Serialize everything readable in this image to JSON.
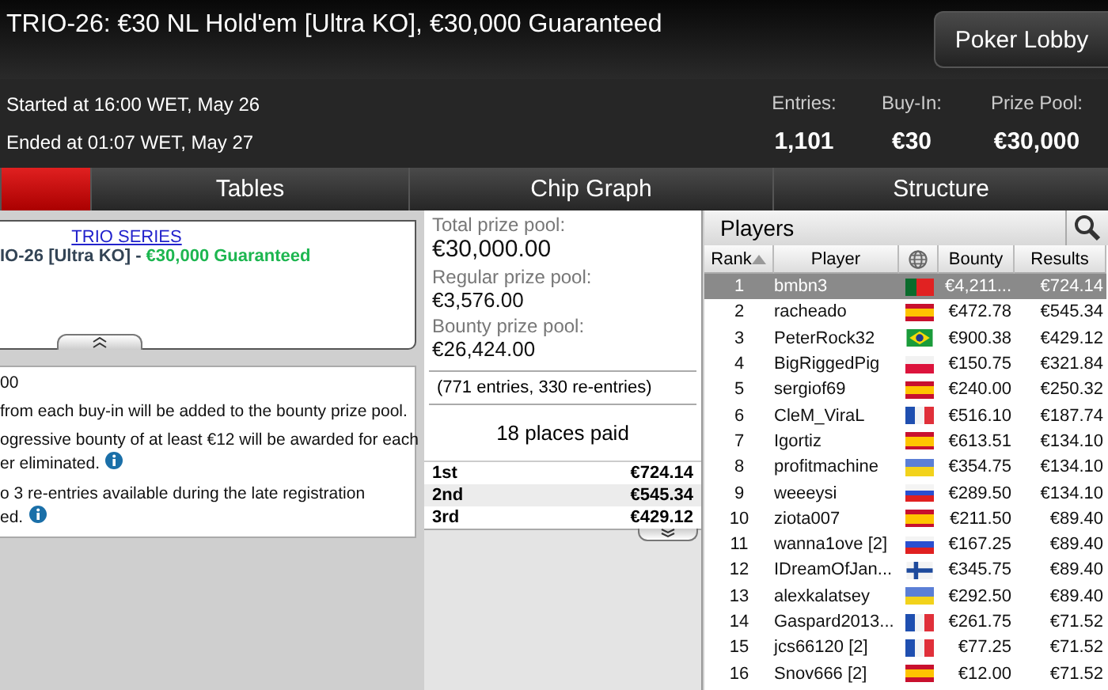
{
  "header": {
    "title": "TRIO-26: €30 NL Hold'em [Ultra KO], €30,000 Guaranteed",
    "lobby_button": "Poker Lobby"
  },
  "info": {
    "started": "Started at 16:00 WET, May 26",
    "ended": "Ended at 01:07 WET, May 27",
    "stats": [
      {
        "label": "Entries:",
        "value": "1,101"
      },
      {
        "label": "Buy-In:",
        "value": "€30"
      },
      {
        "label": "Prize Pool:",
        "value": "€30,000"
      }
    ]
  },
  "tabs": [
    {
      "selected": true
    },
    {
      "label": "Tables",
      "selected": false
    },
    {
      "label": "Chip Graph",
      "selected": false
    },
    {
      "label": "Structure",
      "selected": false
    }
  ],
  "series_box": {
    "link": "TRIO SERIES",
    "name": "IO-26 [Ultra KO] - ",
    "guarantee": "€30,000 Guaranteed"
  },
  "details": [
    {
      "lines": [
        "00"
      ],
      "info": false
    },
    {
      "lines": [
        "from each buy-in will be added to the bounty prize pool."
      ],
      "info": false
    },
    {
      "lines": [
        "ogressive bounty of at least €12 will be awarded for each",
        "er eliminated."
      ],
      "info": true
    },
    {
      "lines": [
        "o 3 re-entries available during the late registration",
        "ed."
      ],
      "info": true
    }
  ],
  "prize": {
    "pools": [
      {
        "label": "Total prize pool:",
        "value": "€30,000.00",
        "main": true
      },
      {
        "label": "Regular prize pool:",
        "value": "€3,576.00",
        "main": false
      },
      {
        "label": "Bounty prize pool:",
        "value": "€26,424.00",
        "main": false
      }
    ],
    "entries": "(771 entries, 330 re-entries)",
    "places": "18 places paid",
    "payouts": [
      {
        "place": "1st",
        "amount": "€724.14"
      },
      {
        "place": "2nd",
        "amount": "€545.34"
      },
      {
        "place": "3rd",
        "amount": "€429.12"
      }
    ]
  },
  "players": {
    "title": "Players",
    "columns": [
      "Rank",
      "Player",
      "Bounty",
      "Results"
    ],
    "rows": [
      {
        "rank": "1",
        "player": "bmbn3",
        "kind": "pt",
        "bounty": "€4,211...",
        "results": "€724.14",
        "selected": true
      },
      {
        "rank": "2",
        "player": "racheado",
        "kind": "es",
        "bounty": "€472.78",
        "results": "€545.34",
        "selected": false
      },
      {
        "rank": "3",
        "player": "PeterRock32",
        "kind": "br",
        "bounty": "€900.38",
        "results": "€429.12",
        "selected": false
      },
      {
        "rank": "4",
        "player": "BigRiggedPig",
        "kind": "pl",
        "bounty": "€150.75",
        "results": "€321.84",
        "selected": false
      },
      {
        "rank": "5",
        "player": "sergiof69",
        "kind": "es",
        "bounty": "€240.00",
        "results": "€250.32",
        "selected": false
      },
      {
        "rank": "6",
        "player": "CleM_ViraL",
        "kind": "fr",
        "bounty": "€516.10",
        "results": "€187.74",
        "selected": false
      },
      {
        "rank": "7",
        "player": "Igortiz",
        "kind": "es",
        "bounty": "€613.51",
        "results": "€134.10",
        "selected": false
      },
      {
        "rank": "8",
        "player": "profitmachine",
        "kind": "ua",
        "bounty": "€354.75",
        "results": "€134.10",
        "selected": false
      },
      {
        "rank": "9",
        "player": "weeeysi",
        "kind": "ru",
        "bounty": "€289.50",
        "results": "€134.10",
        "selected": false
      },
      {
        "rank": "10",
        "player": "ziota007",
        "kind": "es",
        "bounty": "€211.50",
        "results": "€89.40",
        "selected": false
      },
      {
        "rank": "11",
        "player": "wanna1ove [2]",
        "kind": "ru",
        "bounty": "€167.25",
        "results": "€89.40",
        "selected": false
      },
      {
        "rank": "12",
        "player": "IDreamOfJan...",
        "kind": "fi",
        "bounty": "€345.75",
        "results": "€89.40",
        "selected": false
      },
      {
        "rank": "13",
        "player": "alexkalatsey",
        "kind": "ua",
        "bounty": "€292.50",
        "results": "€89.40",
        "selected": false
      },
      {
        "rank": "14",
        "player": "Gaspard2013...",
        "kind": "fr",
        "bounty": "€261.75",
        "results": "€71.52",
        "selected": false
      },
      {
        "rank": "15",
        "player": "jcs66120 [2]",
        "kind": "fr",
        "bounty": "€77.25",
        "results": "€71.52",
        "selected": false
      },
      {
        "rank": "16",
        "player": "Snov666 [2]",
        "kind": "es",
        "bounty": "€12.00",
        "results": "€71.52",
        "selected": false
      }
    ]
  }
}
